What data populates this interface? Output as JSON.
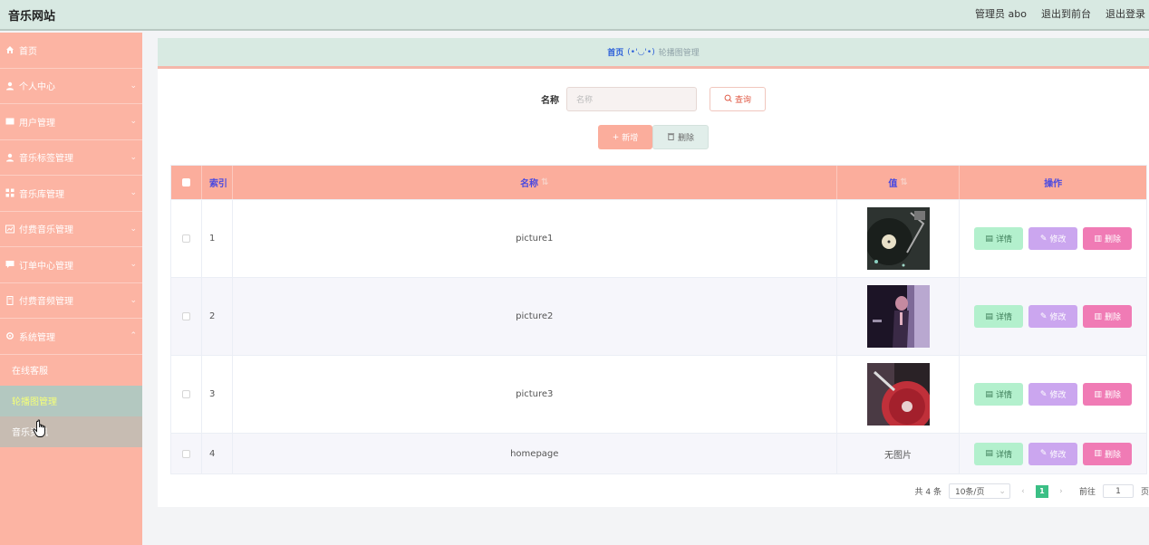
{
  "header": {
    "brand": "音乐网站",
    "admin_label": "管理员 abo",
    "to_front_label": "退出到前台",
    "logout_label": "退出登录"
  },
  "sidebar": {
    "items": [
      {
        "label": "首页",
        "icon": "home-icon",
        "has_chevron": false
      },
      {
        "label": "个人中心",
        "icon": "user-icon",
        "has_chevron": true
      },
      {
        "label": "用户管理",
        "icon": "card-icon",
        "has_chevron": true
      },
      {
        "label": "音乐标签管理",
        "icon": "user-icon",
        "has_chevron": true
      },
      {
        "label": "音乐库管理",
        "icon": "grid-icon",
        "has_chevron": true
      },
      {
        "label": "付费音乐管理",
        "icon": "chart-icon",
        "has_chevron": true
      },
      {
        "label": "订单中心管理",
        "icon": "message-icon",
        "has_chevron": true
      },
      {
        "label": "付费音频管理",
        "icon": "file-icon",
        "has_chevron": true
      },
      {
        "label": "系统管理",
        "icon": "gear-icon",
        "has_chevron": true
      }
    ],
    "sub_items": [
      {
        "label": "在线客服"
      },
      {
        "label": "轮播图管理"
      },
      {
        "label": "音乐资讯"
      }
    ]
  },
  "breadcrumb": {
    "home": "首页",
    "sep": "(•'◡'•)",
    "current": "轮播图管理"
  },
  "search": {
    "label": "名称",
    "placeholder": "名称",
    "query_label": "查询"
  },
  "actions": {
    "add_label": "新增",
    "delete_label": "删除"
  },
  "table": {
    "headers": {
      "index": "索引",
      "name": "名称",
      "value": "值",
      "ops": "操作"
    },
    "rows": [
      {
        "index": "1",
        "name": "picture1",
        "value": "",
        "image": "vinyl-record-image"
      },
      {
        "index": "2",
        "name": "picture2",
        "value": "",
        "image": "singer-portrait-image"
      },
      {
        "index": "3",
        "name": "picture3",
        "value": "",
        "image": "red-vinyl-image"
      },
      {
        "index": "4",
        "name": "homepage",
        "value": "无图片",
        "image": ""
      }
    ],
    "ops": {
      "detail": "详情",
      "edit": "修改",
      "delete": "删除"
    }
  },
  "pagination": {
    "total": "共 4 条",
    "page_size": "10条/页",
    "current_page": "1",
    "goto_label": "前往",
    "goto_value": "1",
    "page_suffix": "页"
  },
  "colors": {
    "sidebar": "#fcb4a3",
    "header": "#d8e9e2",
    "table_head": "#fbad9c",
    "detail_btn": "#b3f0cd",
    "edit_btn": "#cba6ef",
    "delete_btn": "#f07bb5",
    "active_menu_text": "#f4ff78"
  }
}
